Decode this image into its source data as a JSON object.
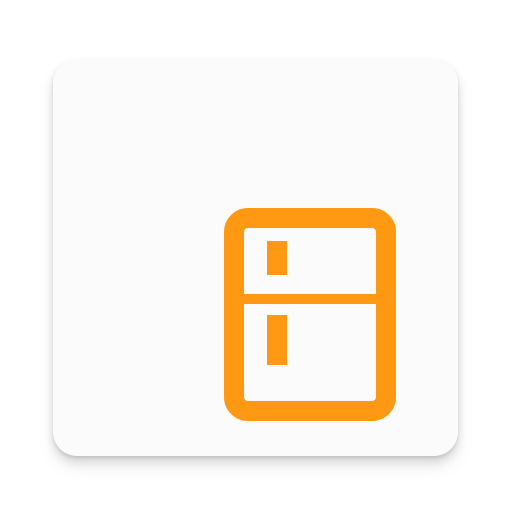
{
  "app": {
    "icon": "fridge-icon",
    "colors": {
      "tile_background": "#fbfbfb",
      "page_background": "#ffffff",
      "accent": "#FF9812"
    }
  }
}
